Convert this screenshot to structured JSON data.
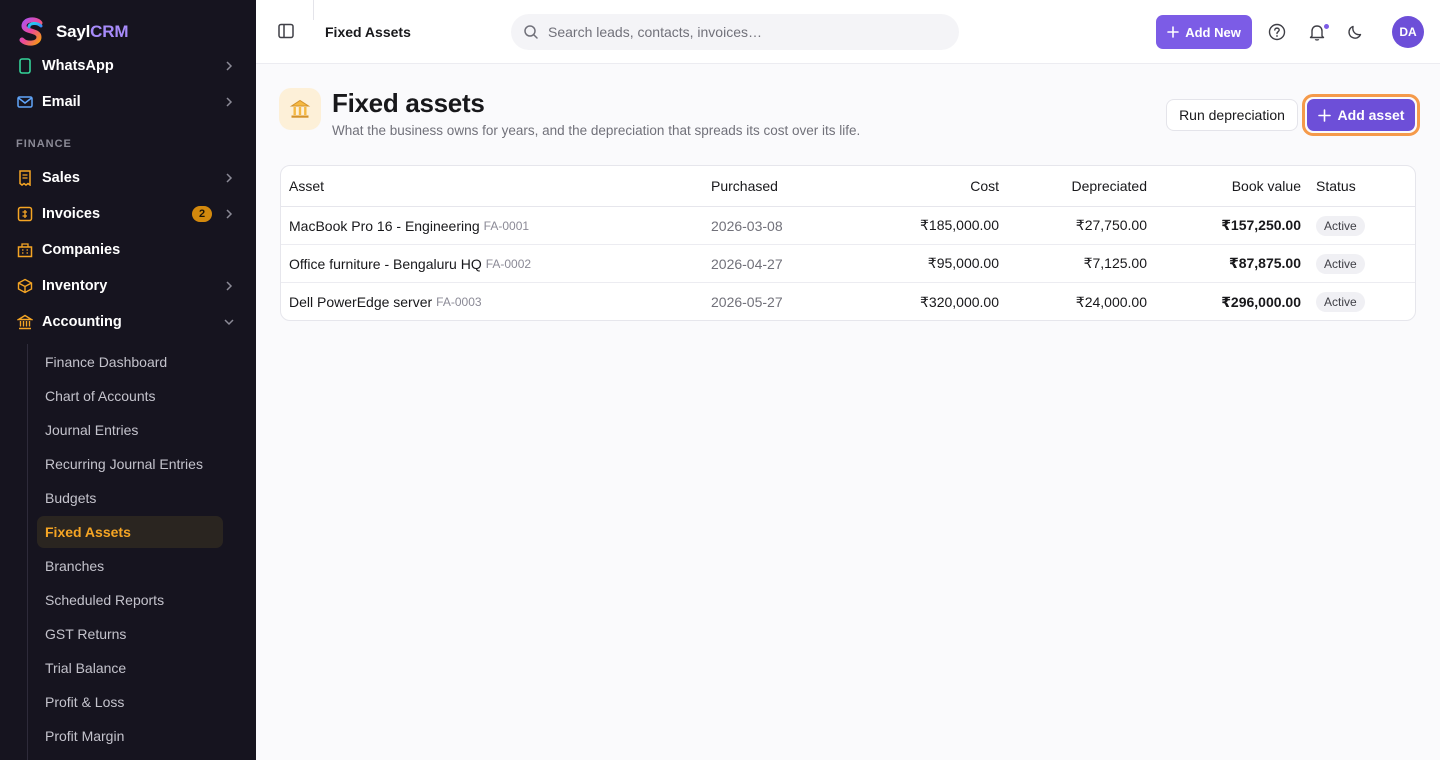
{
  "brand": {
    "name_primary": "Sayl",
    "name_accent": "CRM"
  },
  "colors": {
    "accent": "#7c5ce6",
    "sidebar_bg": "#16141f",
    "active_nav": "#f5a524",
    "focus_ring": "#f59a4a"
  },
  "sidebar": {
    "items": [
      {
        "label": "WhatsApp",
        "icon": "whatsapp-icon"
      },
      {
        "label": "Email",
        "icon": "mail-icon"
      }
    ],
    "section_label": "FINANCE",
    "finance_items": [
      {
        "label": "Sales",
        "icon": "receipt-icon"
      },
      {
        "label": "Invoices",
        "icon": "invoice-icon",
        "badge": "2"
      },
      {
        "label": "Companies",
        "icon": "building-icon"
      },
      {
        "label": "Inventory",
        "icon": "box-icon"
      },
      {
        "label": "Accounting",
        "icon": "bank-icon",
        "expanded": true
      }
    ],
    "accounting_sub": [
      {
        "label": "Finance Dashboard"
      },
      {
        "label": "Chart of Accounts"
      },
      {
        "label": "Journal Entries"
      },
      {
        "label": "Recurring Journal Entries"
      },
      {
        "label": "Budgets"
      },
      {
        "label": "Fixed Assets",
        "active": true
      },
      {
        "label": "Branches"
      },
      {
        "label": "Scheduled Reports"
      },
      {
        "label": "GST Returns"
      },
      {
        "label": "Trial Balance"
      },
      {
        "label": "Profit & Loss"
      },
      {
        "label": "Profit Margin"
      }
    ]
  },
  "topbar": {
    "page": "Fixed Assets",
    "search_placeholder": "Search leads, contacts, invoices…",
    "add_new": "Add New",
    "avatar_initials": "DA"
  },
  "main": {
    "title": "Fixed assets",
    "subtitle": "What the business owns for years, and the depreciation that spreads its cost over its life.",
    "run_depreciation": "Run depreciation",
    "add_asset": "Add asset",
    "table": {
      "columns": [
        "Asset",
        "Purchased",
        "Cost",
        "Depreciated",
        "Book value",
        "Status"
      ],
      "rows": [
        {
          "asset": "MacBook Pro 16 - Engineering",
          "code": "FA-0001",
          "purchased": "2026-03-08",
          "cost": "₹185,000.00",
          "depreciated": "₹27,750.00",
          "book_value": "₹157,250.00",
          "status": "Active"
        },
        {
          "asset": "Office furniture - Bengaluru HQ",
          "code": "FA-0002",
          "purchased": "2026-04-27",
          "cost": "₹95,000.00",
          "depreciated": "₹7,125.00",
          "book_value": "₹87,875.00",
          "status": "Active"
        },
        {
          "asset": "Dell PowerEdge server",
          "code": "FA-0003",
          "purchased": "2026-05-27",
          "cost": "₹320,000.00",
          "depreciated": "₹24,000.00",
          "book_value": "₹296,000.00",
          "status": "Active"
        }
      ]
    }
  }
}
